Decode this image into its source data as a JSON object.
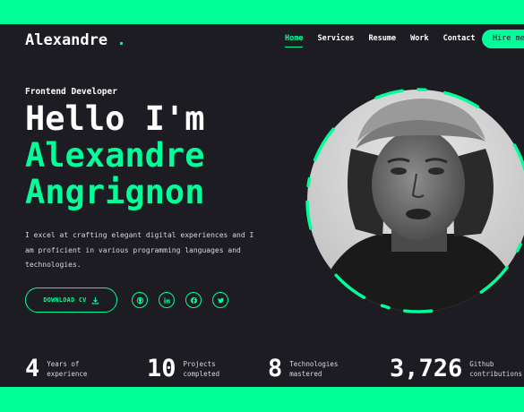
{
  "brand": {
    "name": "Alexandre",
    "dot": "."
  },
  "nav": {
    "items": [
      "Home",
      "Services",
      "Resume",
      "Work",
      "Contact"
    ],
    "hire_label": "Hire me"
  },
  "hero": {
    "role": "Frontend Developer",
    "greeting": "Hello I'm",
    "first_name": "Alexandre",
    "last_name": "Angrignon",
    "description": "I excel at crafting elegant digital experiences and I am proficient in various programming languages and technologies.",
    "download_label": "DOWNLOAD CV"
  },
  "social": [
    "github-icon",
    "linkedin-icon",
    "facebook-icon",
    "twitter-icon"
  ],
  "stats": [
    {
      "value": "4",
      "label": "Years of\nexperience"
    },
    {
      "value": "10",
      "label": "Projects\ncompleted"
    },
    {
      "value": "8",
      "label": "Technologies\nmastered"
    },
    {
      "value": "3,726",
      "label": "Github\ncontributions"
    }
  ],
  "colors": {
    "accent": "#00ff99",
    "background": "#1c1c22"
  }
}
